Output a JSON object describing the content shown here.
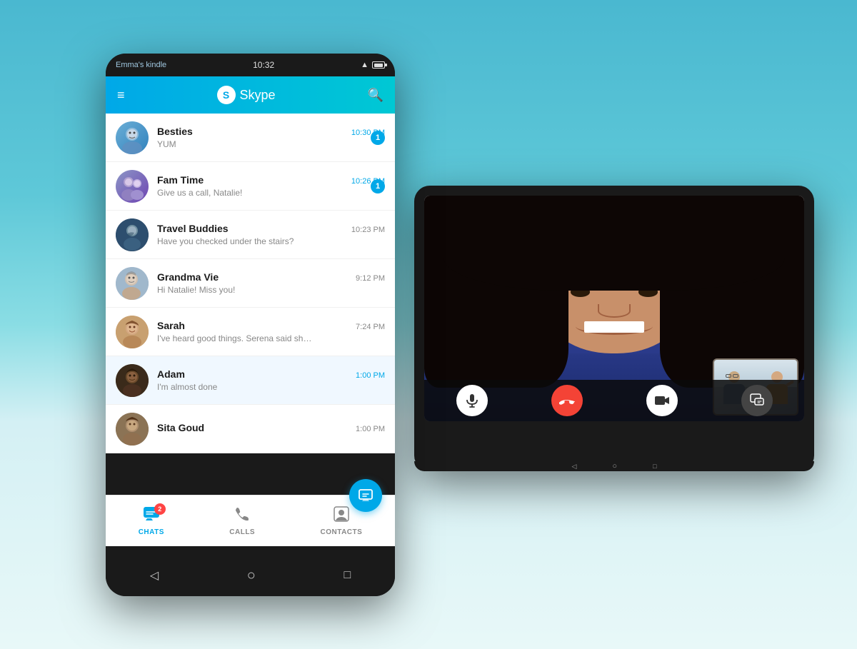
{
  "background": {
    "gradient_top": "#4ab8cc",
    "gradient_bottom": "#e8f8f8"
  },
  "tablet_portrait": {
    "device_name": "Emma's kindle",
    "time": "10:32",
    "app_title": "Skype",
    "chats": [
      {
        "name": "Besties",
        "preview": "YUM",
        "time": "10:30 PM",
        "badge": "1",
        "avatar_class": "av-besties"
      },
      {
        "name": "Fam Time",
        "preview": "Give us a call, Natalie!",
        "time": "10:26 PM",
        "badge": "1",
        "avatar_class": "av-fam"
      },
      {
        "name": "Travel Buddies",
        "preview": "Have you checked under the stairs?",
        "time": "10:23 PM",
        "badge": "",
        "avatar_class": "av-travel"
      },
      {
        "name": "Grandma Vie",
        "preview": "Hi Natalie! Miss you!",
        "time": "9:12 PM",
        "badge": "",
        "avatar_class": "av-grandma"
      },
      {
        "name": "Sarah",
        "preview": "I've heard good things. Serena said she...",
        "time": "7:24 PM",
        "badge": "",
        "avatar_class": "av-sarah"
      },
      {
        "name": "Adam",
        "preview": "I'm almost done",
        "time": "1:00 PM",
        "badge": "",
        "avatar_class": "av-adam"
      },
      {
        "name": "Sita Goud",
        "preview": "",
        "time": "1:00 PM",
        "badge": "",
        "avatar_class": "av-sita"
      }
    ],
    "bottom_nav": [
      {
        "label": "CHATS",
        "active": true,
        "badge": "2",
        "icon": "💬"
      },
      {
        "label": "CALLS",
        "active": false,
        "badge": "",
        "icon": "📞"
      },
      {
        "label": "CONTACTS",
        "active": false,
        "badge": "",
        "icon": "👤"
      }
    ]
  },
  "tablet_landscape": {
    "call_controls": [
      {
        "type": "microphone",
        "label": "🎙",
        "style": "white"
      },
      {
        "type": "end-call",
        "label": "📵",
        "style": "red"
      },
      {
        "type": "video",
        "label": "🎥",
        "style": "white"
      },
      {
        "type": "screen-share",
        "label": "📲",
        "style": "dark"
      }
    ],
    "android_nav": [
      "◁",
      "○",
      "□"
    ]
  }
}
